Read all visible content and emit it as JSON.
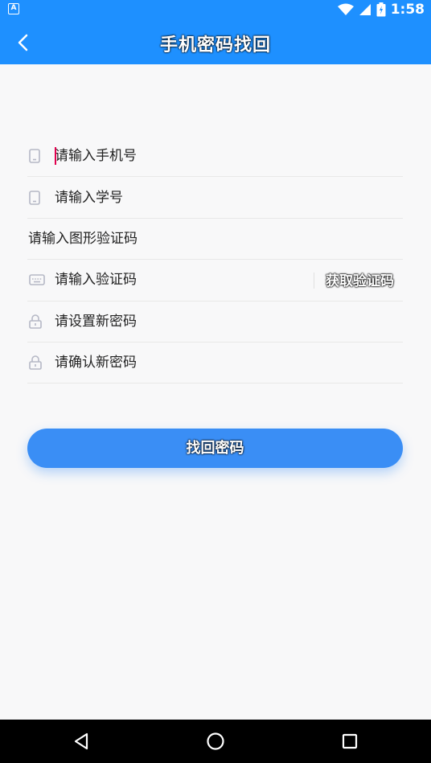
{
  "status_bar": {
    "time": "1:58",
    "app_icon": "A",
    "icons": [
      "wifi-icon",
      "cellular-signal-icon",
      "battery-icon"
    ]
  },
  "header": {
    "title": "手机密码找回",
    "back_icon": "chevron-left-icon"
  },
  "form": {
    "phone": {
      "placeholder": "请输入手机号",
      "icon": "phone-icon"
    },
    "student_id": {
      "placeholder": "请输入学号",
      "icon": "phone-icon"
    },
    "captcha": {
      "placeholder": "请输入图形验证码"
    },
    "sms_code": {
      "placeholder": "请输入验证码",
      "icon": "keyboard-icon",
      "get_code_label": "获取验证码"
    },
    "new_password": {
      "placeholder": "请设置新密码",
      "icon": "lock-icon"
    },
    "confirm_password": {
      "placeholder": "请确认新密码",
      "icon": "lock-icon"
    }
  },
  "submit_label": "找回密码",
  "colors": {
    "primary": "#1e90ff",
    "button": "#3a8ef5",
    "background": "#f8f8f9",
    "icon": "#b5b8c5"
  },
  "nav": {
    "icons": [
      "back-triangle-icon",
      "home-circle-icon",
      "recents-square-icon"
    ]
  }
}
